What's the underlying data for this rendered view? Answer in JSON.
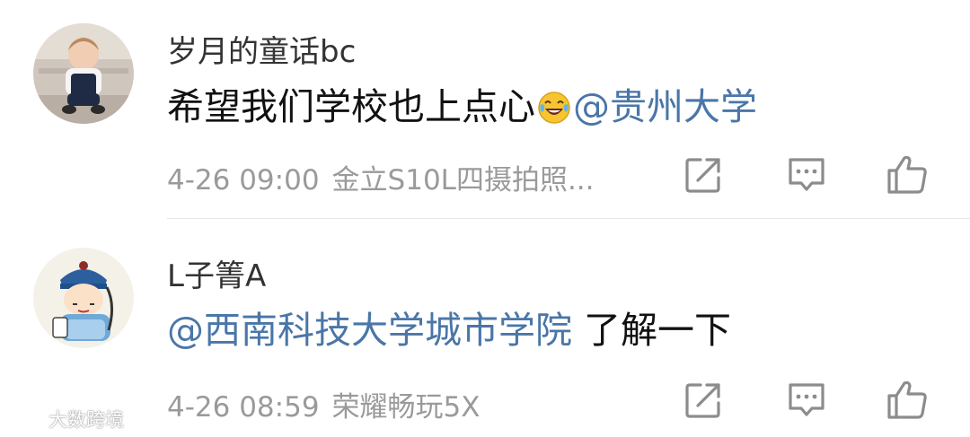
{
  "comments": [
    {
      "username": "岁月的童话bc",
      "avatar_icon": "baby-photo-avatar",
      "text_before": "希望我们学校也上点心",
      "emoji_icon": "laughing-tears-emoji",
      "mention": "@贵州大学",
      "text_after": "",
      "time": "4-26 09:00",
      "device": "金立S10L四摄拍照...",
      "actions": [
        "repost-icon",
        "comment-icon",
        "like-icon"
      ]
    },
    {
      "username": "L子箐A",
      "avatar_icon": "cartoon-qing-official-avatar",
      "text_before": "",
      "mention": "@西南科技大学城市学院",
      "text_after": " 了解一下",
      "time": "4-26 08:59",
      "device": "荣耀畅玩5X",
      "actions": [
        "repost-icon",
        "comment-icon",
        "like-icon"
      ]
    }
  ],
  "watermark": {
    "text": "大数跨境",
    "icon": "weibo-logo-icon"
  },
  "colors": {
    "mention": "#4a76a8",
    "meta_text": "#9a9a9a",
    "content_text": "#111111",
    "icon_stroke": "#8c8c8c"
  }
}
